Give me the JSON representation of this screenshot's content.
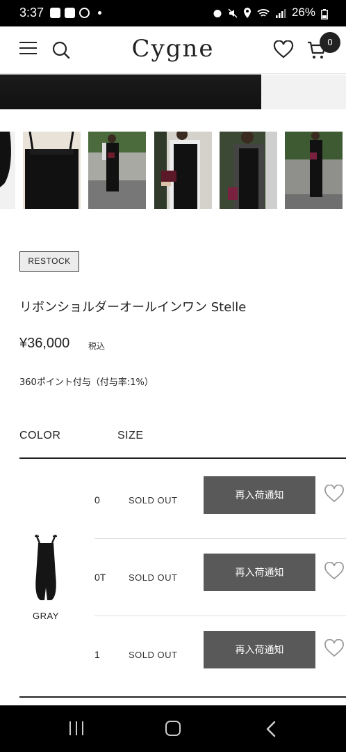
{
  "status_bar": {
    "time": "3:37",
    "battery": "26%"
  },
  "header": {
    "logo": "Cygne",
    "cart_count": "0"
  },
  "product": {
    "badge": "RESTOCK",
    "name": "リボンショルダーオールインワン Stelle",
    "price": "¥36,000",
    "tax_label": "税込",
    "points": "360ポイント付与（付与率:1%）"
  },
  "table": {
    "color_header": "COLOR",
    "size_header": "SIZE",
    "variant": {
      "color": "GRAY",
      "sizes": [
        {
          "size": "0",
          "status": "SOLD OUT",
          "button": "再入荷通知"
        },
        {
          "size": "0T",
          "status": "SOLD OUT",
          "button": "再入荷通知"
        },
        {
          "size": "1",
          "status": "SOLD OUT",
          "button": "再入荷通知"
        }
      ]
    }
  },
  "colors": {
    "notify_button_bg": "#595959",
    "badge_bg": "#ececec"
  }
}
